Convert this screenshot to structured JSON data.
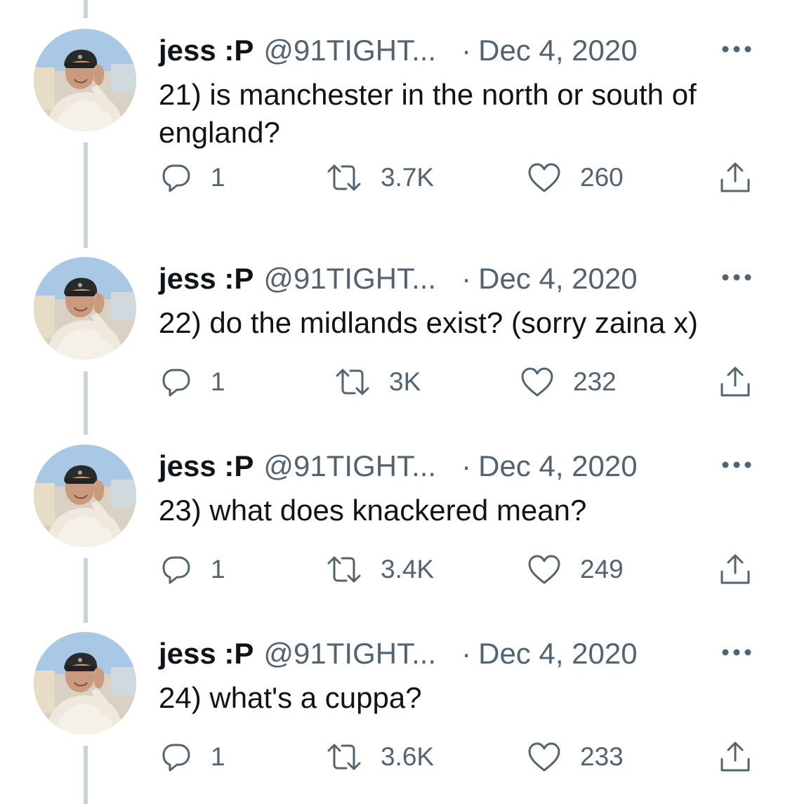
{
  "colors": {
    "text": "#0f1419",
    "secondary": "#536471",
    "thread_line": "#c9d3dc"
  },
  "tweets": [
    {
      "name": "jess :P",
      "handle": "@91TIGHT...",
      "separator": "·",
      "date": "Dec 4, 2020",
      "text": "21) is manchester in the north or south of england?",
      "replies": "1",
      "retweets": "3.7K",
      "likes": "260"
    },
    {
      "name": "jess :P",
      "handle": "@91TIGHT...",
      "separator": "·",
      "date": "Dec 4, 2020",
      "text": "22) do the midlands exist? (sorry zaina x)",
      "replies": "1",
      "retweets": "3K",
      "likes": "232"
    },
    {
      "name": "jess :P",
      "handle": "@91TIGHT...",
      "separator": "·",
      "date": "Dec 4, 2020",
      "text": "23) what does knackered mean?",
      "replies": "1",
      "retweets": "3.4K",
      "likes": "249"
    },
    {
      "name": "jess :P",
      "handle": "@91TIGHT...",
      "separator": "·",
      "date": "Dec 4, 2020",
      "text": "24) what's a cuppa?",
      "replies": "1",
      "retweets": "3.6K",
      "likes": "233"
    }
  ],
  "icons": {
    "reply": "reply-icon",
    "retweet": "retweet-icon",
    "like": "heart-icon",
    "share": "share-icon",
    "more": "more-icon",
    "avatar": "avatar"
  }
}
